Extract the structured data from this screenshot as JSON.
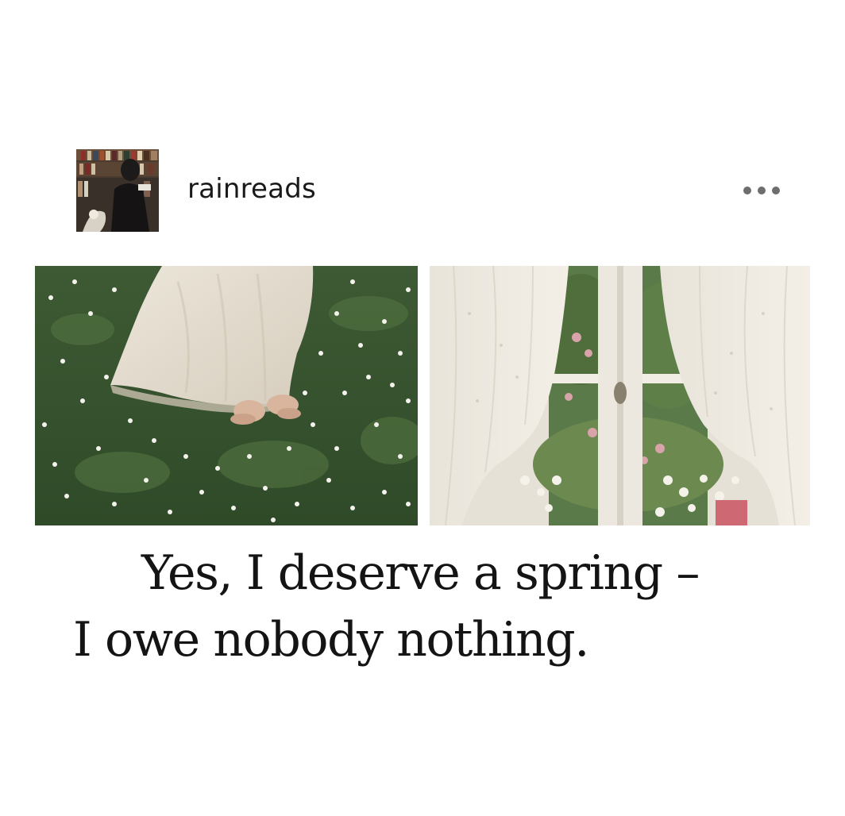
{
  "post": {
    "username": "rainreads",
    "more_label": "More options",
    "caption": {
      "line1": "Yes, I deserve a spring –",
      "line2": "I owe nobody nothing."
    }
  },
  "images": [
    {
      "semantic": "barefoot-lace-dress-on-grass-photo"
    },
    {
      "semantic": "lace-curtain-window-garden-photo"
    }
  ],
  "colors": {
    "background": "#ffffff",
    "text": "#141414",
    "username": "#1a1a1a",
    "more_dots": "#6e6e6e"
  }
}
